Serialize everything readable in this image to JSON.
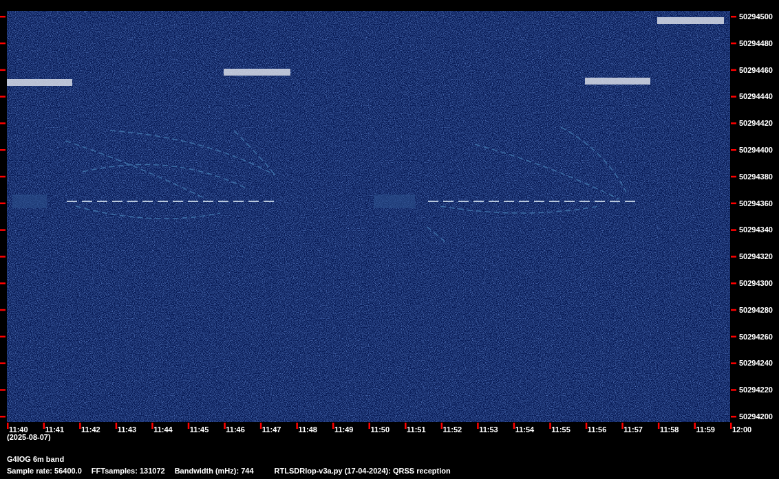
{
  "frequency_axis": {
    "labels": [
      "50294500",
      "50294480",
      "50294460",
      "50294440",
      "50294420",
      "50294400",
      "50294380",
      "50294360",
      "50294340",
      "50294320",
      "50294300",
      "50294280",
      "50294260",
      "50294240",
      "50294220",
      "50294200"
    ]
  },
  "time_axis": {
    "labels": [
      "11:40",
      "11:41",
      "11:42",
      "11:43",
      "11:44",
      "11:45",
      "11:46",
      "11:47",
      "11:48",
      "11:49",
      "11:50",
      "11:51",
      "11:52",
      "11:53",
      "11:54",
      "11:55",
      "11:56",
      "11:57",
      "11:58",
      "11:59",
      "12:00"
    ]
  },
  "date": "(2025-08-07)",
  "title": "G4IOG 6m band",
  "info": [
    "Sample rate: 56400.0",
    "FFTsamples: 131072",
    "Bandwidth (mHz): 744",
    "RTLSDRlop-v3a.py (17-04-2024): QRSS reception"
  ]
}
